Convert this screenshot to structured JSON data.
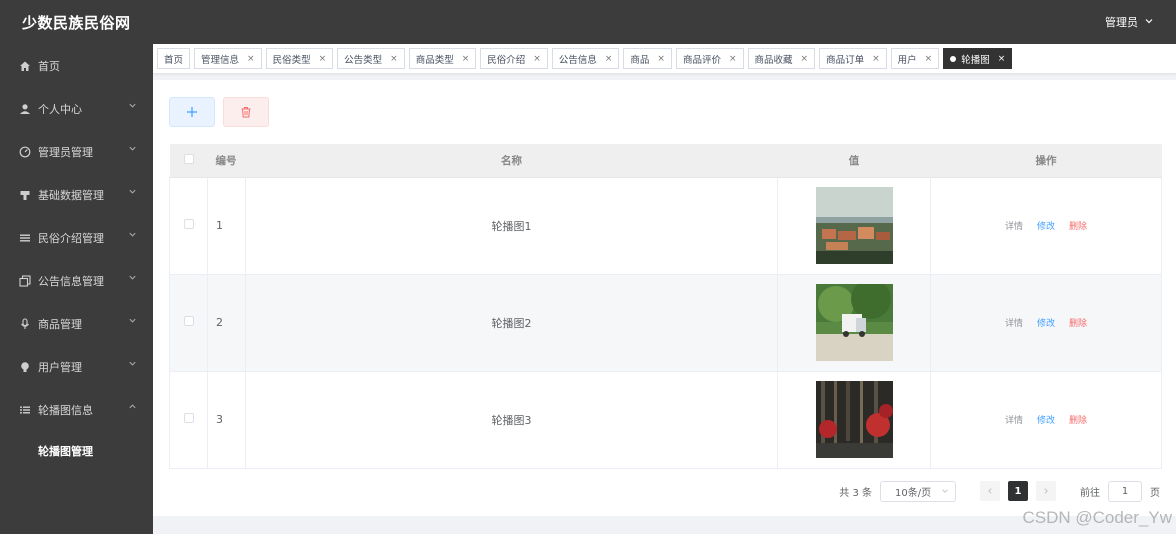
{
  "header": {
    "brand": "少数民族民俗网",
    "user": "管理员"
  },
  "sidebar": {
    "items": [
      {
        "label": "首页",
        "icon": "home-icon",
        "has_arrow": false
      },
      {
        "label": "个人中心",
        "icon": "user-icon",
        "has_arrow": true
      },
      {
        "label": "管理员管理",
        "icon": "gauge-icon",
        "has_arrow": true
      },
      {
        "label": "基础数据管理",
        "icon": "stamp-icon",
        "has_arrow": true
      },
      {
        "label": "民俗介绍管理",
        "icon": "list-icon",
        "has_arrow": true
      },
      {
        "label": "公告信息管理",
        "icon": "copy-icon",
        "has_arrow": true
      },
      {
        "label": "商品管理",
        "icon": "mic-icon",
        "has_arrow": true
      },
      {
        "label": "用户管理",
        "icon": "bulb-icon",
        "has_arrow": true
      },
      {
        "label": "轮播图信息",
        "icon": "menu-icon",
        "has_arrow": true,
        "expanded": true
      }
    ],
    "subitem": "轮播图管理"
  },
  "tabs": [
    "首页",
    "管理信息",
    "民俗类型",
    "公告类型",
    "商品类型",
    "民俗介绍",
    "公告信息",
    "商品",
    "商品评价",
    "商品收藏",
    "商品订单",
    "用户",
    "轮播图"
  ],
  "active_tab": "轮播图",
  "table": {
    "headers": {
      "id": "编号",
      "name": "名称",
      "value": "值",
      "actions": "操作"
    },
    "rows": [
      {
        "id": "1",
        "name": "轮播图1"
      },
      {
        "id": "2",
        "name": "轮播图2"
      },
      {
        "id": "3",
        "name": "轮播图3"
      }
    ],
    "actions": {
      "detail": "详情",
      "edit": "修改",
      "delete": "删除"
    }
  },
  "pagination": {
    "total": "共 3 条",
    "page_size": "10条/页",
    "current_page": "1",
    "goto_label": "前往",
    "goto_value": "1",
    "page_unit": "页"
  },
  "watermark": "CSDN @Coder_Yw",
  "colors": {
    "header_bg": "#3c3c3c",
    "primary": "#409eff",
    "danger": "#f56c6c"
  }
}
